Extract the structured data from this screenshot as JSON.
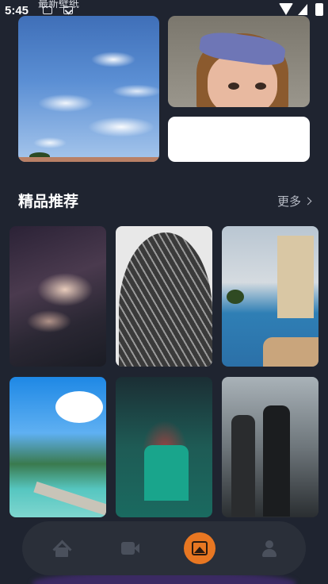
{
  "status_bar": {
    "time": "5:45",
    "app_name": "最新壁纸"
  },
  "banners": [
    {
      "name": "sky-clouds"
    },
    {
      "name": "girl-headband"
    },
    {
      "name": "blank"
    }
  ],
  "section": {
    "title": "精品推荐",
    "more_label": "更多"
  },
  "wallpapers": [
    {
      "name": "nebula"
    },
    {
      "name": "glass-tower"
    },
    {
      "name": "resort-pool"
    },
    {
      "name": "tropical-beach"
    },
    {
      "name": "basketball-player"
    },
    {
      "name": "dark-knight"
    }
  ],
  "nav": {
    "items": [
      {
        "icon": "home-icon",
        "active": false
      },
      {
        "icon": "video-icon",
        "active": false
      },
      {
        "icon": "image-icon",
        "active": true
      },
      {
        "icon": "user-icon",
        "active": false
      }
    ],
    "active_color": "#e87722"
  },
  "colors": {
    "background": "#1f2430",
    "nav_background": "#2a2f39"
  }
}
